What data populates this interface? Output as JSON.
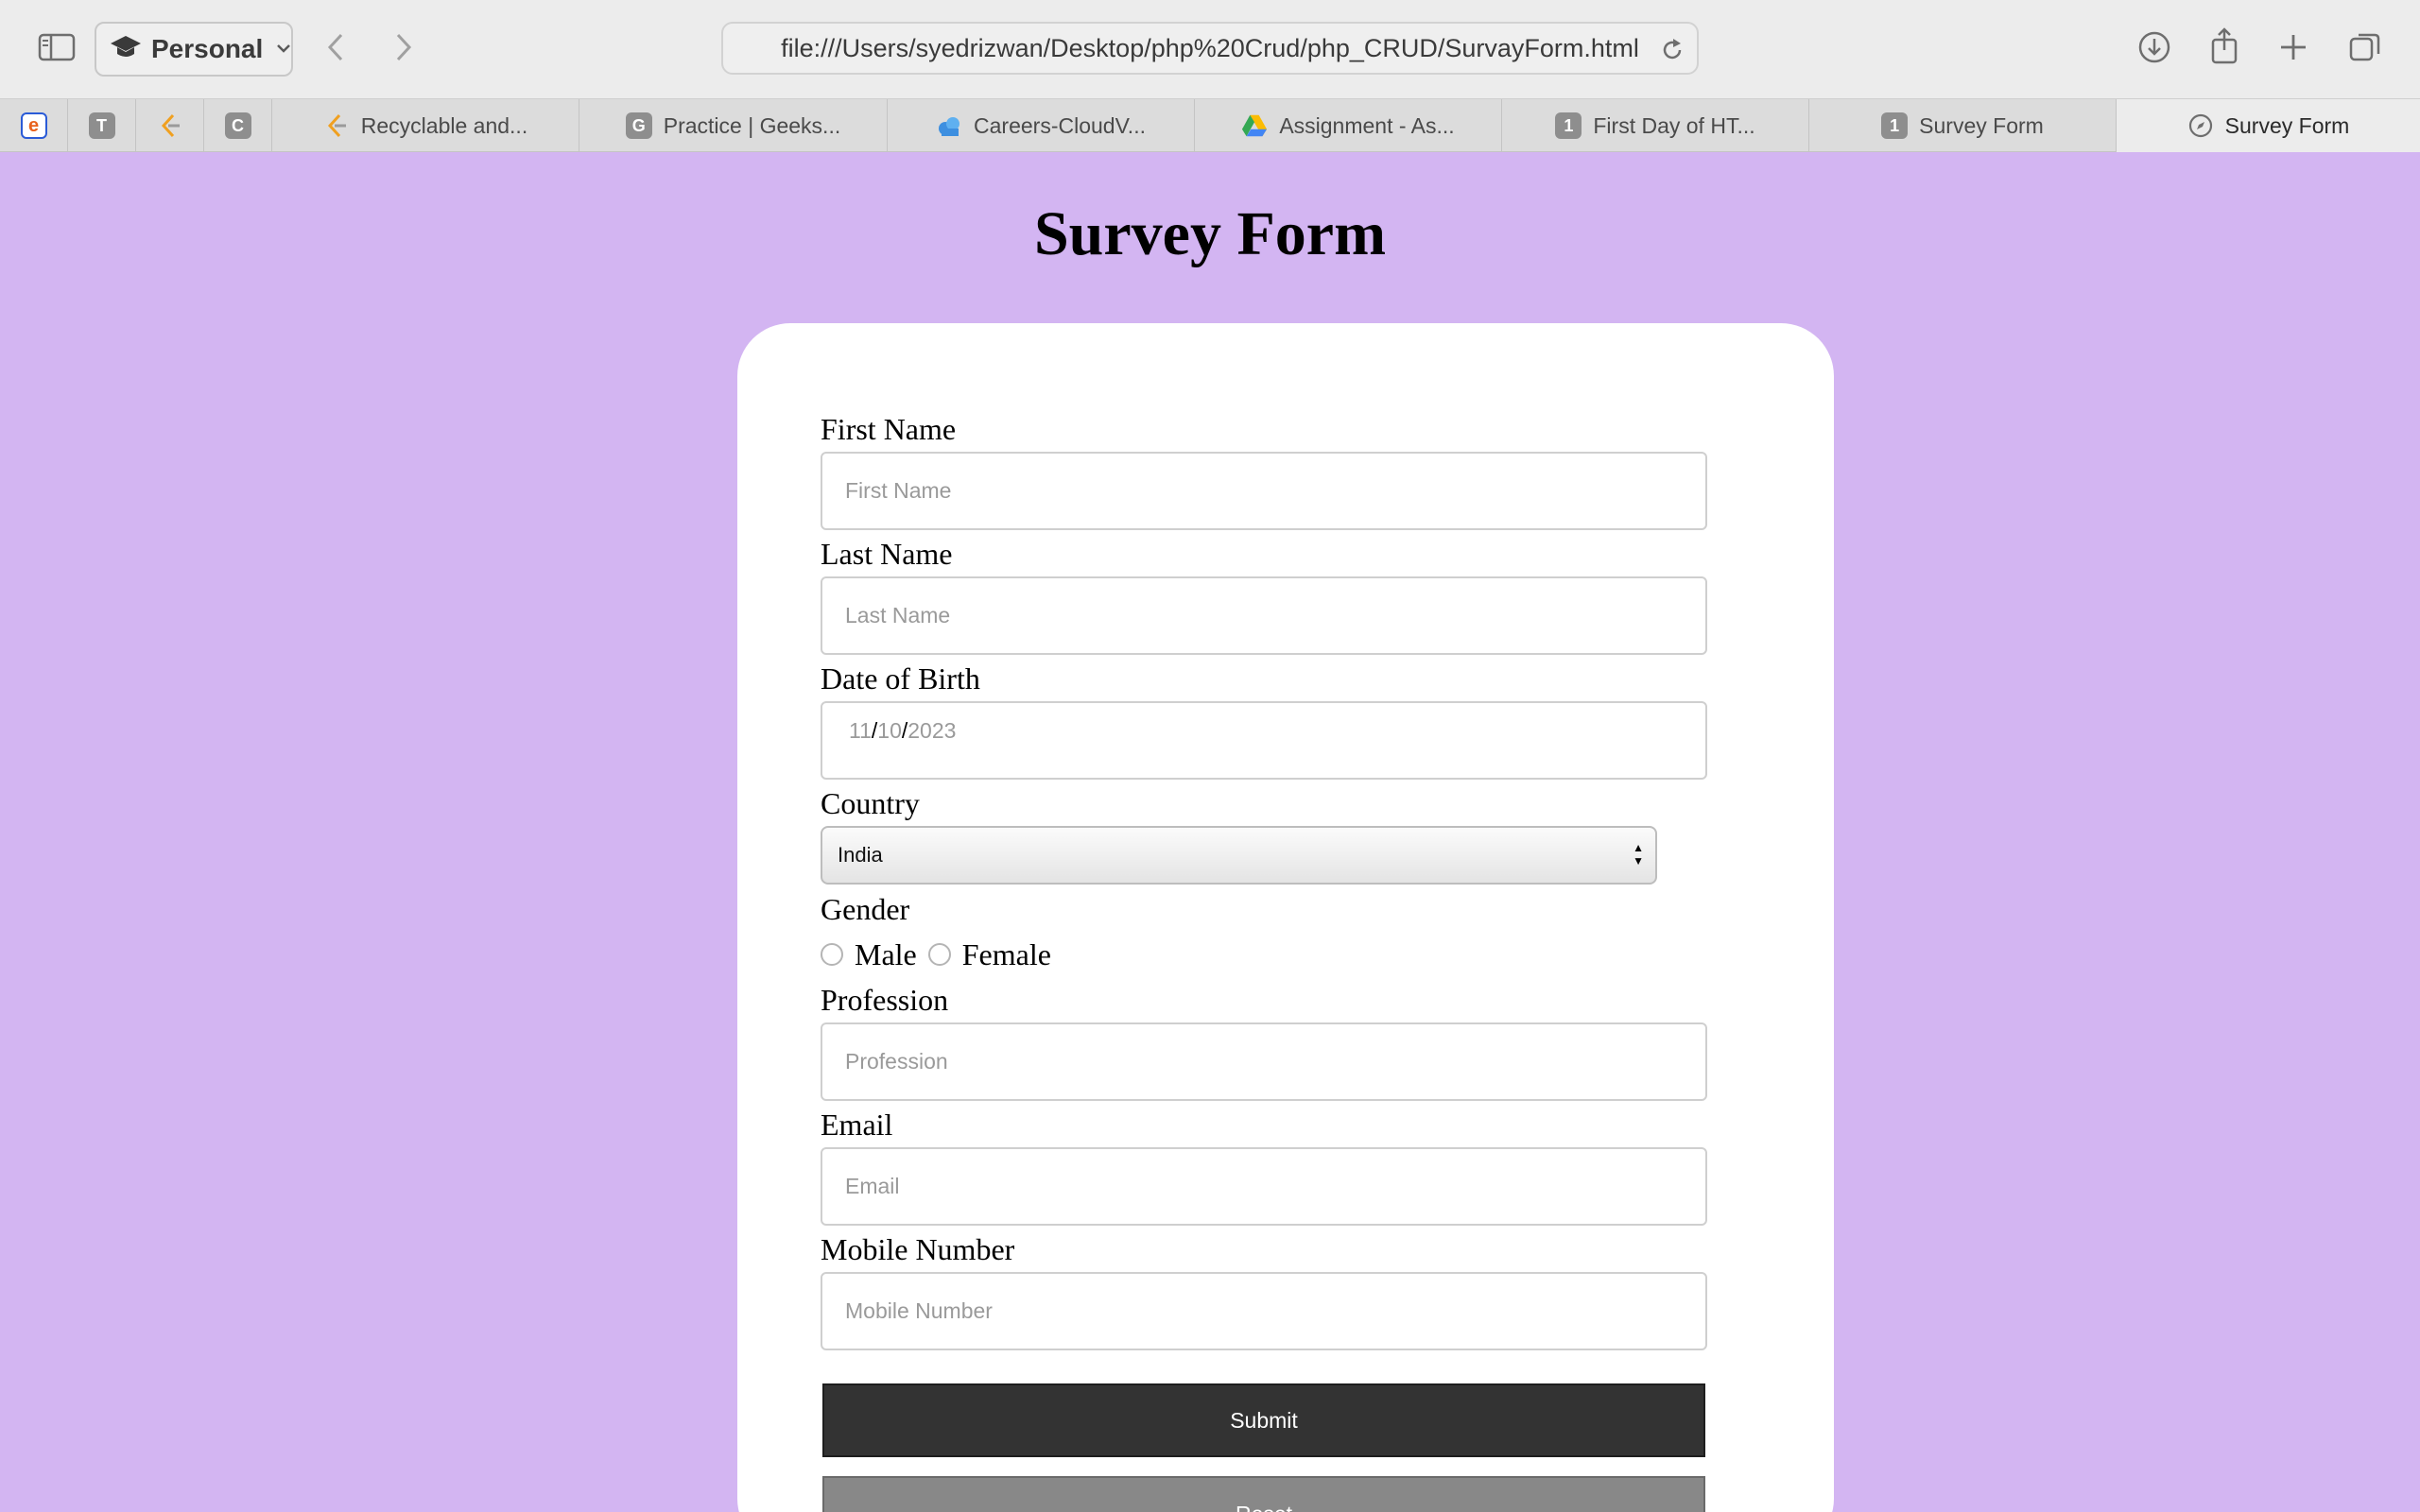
{
  "browser": {
    "profile_label": "Personal",
    "url": "file:///Users/syedrizwan/Desktop/php%20Crud/php_CRUD/SurvayForm.html"
  },
  "tabs": [
    {
      "label": "",
      "icon": "e-logo-icon"
    },
    {
      "label": "",
      "icon": "T"
    },
    {
      "label": "",
      "icon": "leetcode-icon"
    },
    {
      "label": "",
      "icon": "C"
    },
    {
      "label": "Recyclable and...",
      "icon": "leetcode-icon"
    },
    {
      "label": "Practice | Geeks...",
      "icon": "G"
    },
    {
      "label": "Careers-CloudV...",
      "icon": "cloud-icon"
    },
    {
      "label": "Assignment - As...",
      "icon": "drive-icon"
    },
    {
      "label": "First Day of HT...",
      "icon": "1"
    },
    {
      "label": "Survey Form",
      "icon": "1"
    },
    {
      "label": "Survey Form",
      "icon": "compass-icon",
      "active": true
    }
  ],
  "page": {
    "title": "Survey Form",
    "fields": {
      "first_name": {
        "label": "First Name",
        "placeholder": "First Name"
      },
      "last_name": {
        "label": "Last Name",
        "placeholder": "Last Name"
      },
      "dob": {
        "label": "Date of Birth",
        "month": "11",
        "day": "10",
        "year": "2023",
        "sep": "/"
      },
      "country": {
        "label": "Country",
        "value": "India"
      },
      "gender": {
        "label": "Gender",
        "options": [
          "Male",
          "Female"
        ]
      },
      "profession": {
        "label": "Profession",
        "placeholder": "Profession"
      },
      "email": {
        "label": "Email",
        "placeholder": "Email"
      },
      "mobile": {
        "label": "Mobile Number",
        "placeholder": "Mobile Number"
      }
    },
    "buttons": {
      "submit": "Submit",
      "reset": "Reset"
    }
  },
  "colors": {
    "page_bg": "#d3b5f2",
    "submit_bg": "#333333",
    "reset_bg": "#888888"
  }
}
